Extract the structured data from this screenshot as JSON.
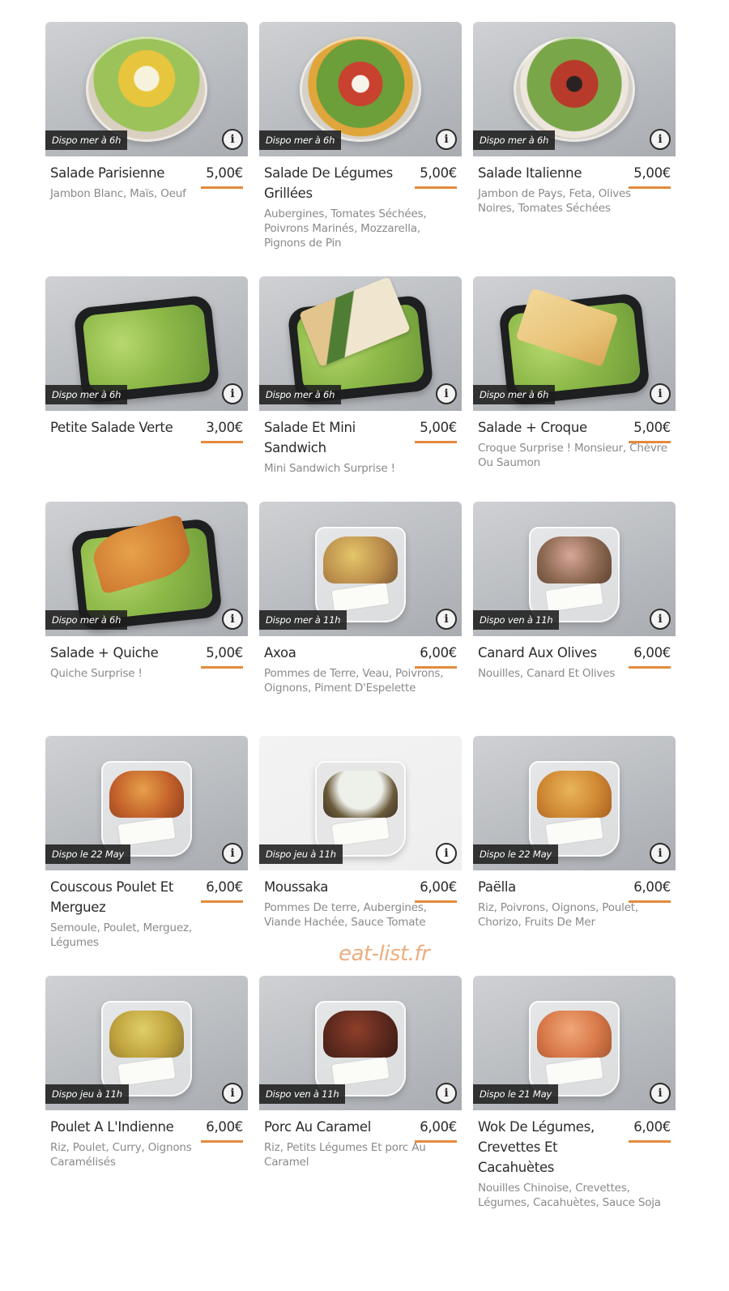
{
  "watermark": "eat-list.fr",
  "accent_color": "#e48a3e",
  "info_icon_glyph": "i",
  "products": [
    {
      "badge": "Dispo mer à 6h",
      "name": "Salade Parisienne",
      "price": "5,00€",
      "desc": "Jambon Blanc, Maïs, Oeuf"
    },
    {
      "badge": "Dispo mer à 6h",
      "name": "Salade De Légumes Grillées",
      "price": "5,00€",
      "desc": "Aubergines, Tomates Séchées, Poivrons Marinés, Mozzarella, Pignons de Pin"
    },
    {
      "badge": "Dispo mer à 6h",
      "name": "Salade Italienne",
      "price": "5,00€",
      "desc": "Jambon de Pays, Feta, Olives Noires, Tomates Séchées"
    },
    {
      "badge": "Dispo mer à 6h",
      "name": "Petite Salade Verte",
      "price": "3,00€",
      "desc": ""
    },
    {
      "badge": "Dispo mer à 6h",
      "name": "Salade Et Mini Sandwich",
      "price": "5,00€",
      "desc": "Mini Sandwich Surprise !"
    },
    {
      "badge": "Dispo mer à 6h",
      "name": "Salade + Croque",
      "price": "5,00€",
      "desc": "Croque Surprise ! Monsieur, Chèvre Ou Saumon"
    },
    {
      "badge": "Dispo mer à 6h",
      "name": "Salade + Quiche",
      "price": "5,00€",
      "desc": "Quiche Surprise !"
    },
    {
      "badge": "Dispo mer à 11h",
      "name": "Axoa",
      "price": "6,00€",
      "desc": "Pommes de Terre, Veau, Poivrons, Oignons, Piment D'Espelette"
    },
    {
      "badge": "Dispo ven à 11h",
      "name": "Canard Aux Olives",
      "price": "6,00€",
      "desc": "Nouilles, Canard Et Olives"
    },
    {
      "badge": "Dispo le 22 May",
      "name": "Couscous Poulet Et Merguez",
      "price": "6,00€",
      "desc": "Semoule, Poulet, Merguez, Légumes"
    },
    {
      "badge": "Dispo jeu à 11h",
      "name": "Moussaka",
      "price": "6,00€",
      "desc": "Pommes De terre, Aubergines, Viande Hachée, Sauce Tomate"
    },
    {
      "badge": "Dispo le 22 May",
      "name": "Paëlla",
      "price": "6,00€",
      "desc": "Riz, Poivrons, Oignons, Poulet, Chorizo, Fruits De Mer"
    },
    {
      "badge": "Dispo jeu à 11h",
      "name": "Poulet A L'Indienne",
      "price": "6,00€",
      "desc": "Riz, Poulet, Curry, Oignons Caramélisés"
    },
    {
      "badge": "Dispo ven à 11h",
      "name": "Porc Au Caramel",
      "price": "6,00€",
      "desc": "Riz, Petits Légumes Et porc Au Caramel"
    },
    {
      "badge": "Dispo le 21 May",
      "name": "Wok De Légumes, Crevettes Et Cacahuètes",
      "price": "6,00€",
      "desc": "Nouilles Chinoise, Crevettes, Légumes, Cacahuètes, Sauce Soja"
    }
  ]
}
